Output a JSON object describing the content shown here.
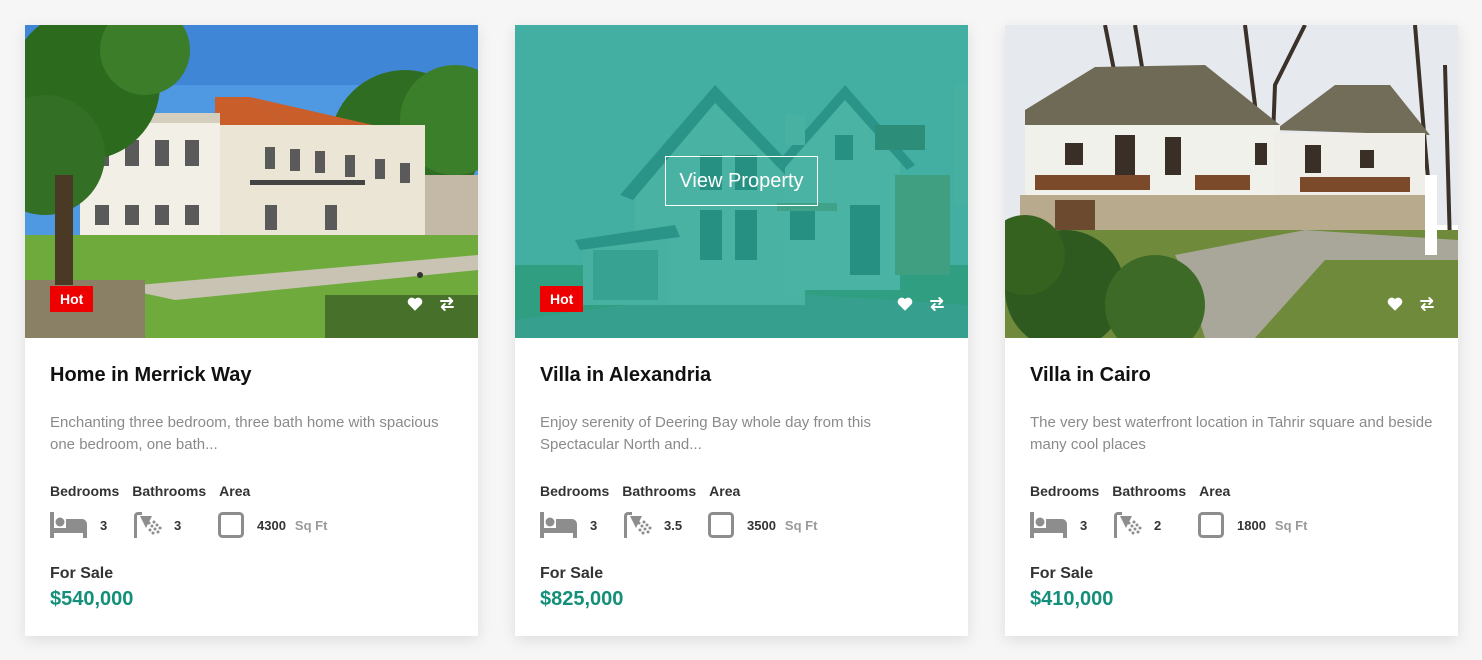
{
  "colors": {
    "accent": "#138f7a",
    "hot_badge": "#ee0000",
    "hover_overlay": "#1ba08c",
    "icon_gray": "#8d8d8d"
  },
  "listings": [
    {
      "title": "Home in Merrick Way",
      "description": "Enchanting three bedroom, three bath home with spacious one bedroom, one bath...",
      "badge": "Hot",
      "labels": {
        "bedrooms": "Bedrooms",
        "bathrooms": "Bathrooms",
        "area": "Area"
      },
      "bedrooms": "3",
      "bathrooms": "3",
      "area": "4300",
      "area_unit": "Sq Ft",
      "status": "For Sale",
      "price": "$540,000",
      "icons": [
        "heart-icon",
        "swap-icon",
        "bed-icon",
        "shower-icon",
        "area-square-icon"
      ]
    },
    {
      "title": "Villa in Alexandria",
      "description": "Enjoy serenity of Deering Bay whole day from this Spectacular North and...",
      "badge": "Hot",
      "hover_button": "View Property",
      "labels": {
        "bedrooms": "Bedrooms",
        "bathrooms": "Bathrooms",
        "area": "Area"
      },
      "bedrooms": "3",
      "bathrooms": "3.5",
      "area": "3500",
      "area_unit": "Sq Ft",
      "status": "For Sale",
      "price": "$825,000",
      "icons": [
        "heart-icon",
        "swap-icon",
        "bed-icon",
        "shower-icon",
        "area-square-icon"
      ]
    },
    {
      "title": "Villa in Cairo",
      "description": "The very best waterfront location in Tahrir square and beside many cool places",
      "labels": {
        "bedrooms": "Bedrooms",
        "bathrooms": "Bathrooms",
        "area": "Area"
      },
      "bedrooms": "3",
      "bathrooms": "2",
      "area": "1800",
      "area_unit": "Sq Ft",
      "status": "For Sale",
      "price": "$410,000",
      "icons": [
        "heart-icon",
        "swap-icon",
        "bed-icon",
        "shower-icon",
        "area-square-icon"
      ]
    }
  ]
}
